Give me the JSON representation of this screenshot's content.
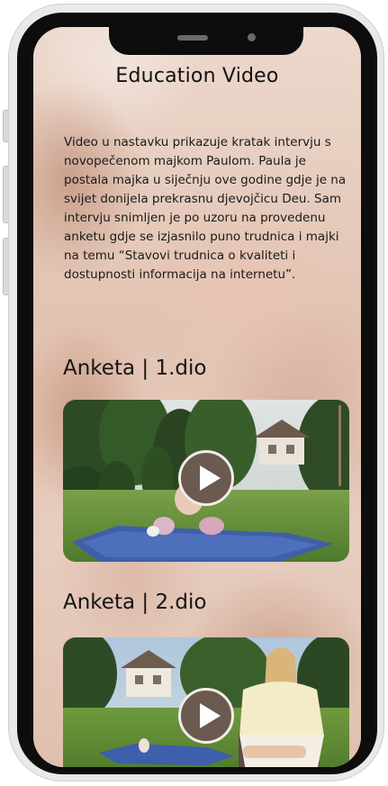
{
  "page": {
    "title": "Education Video",
    "intro": "Video u nastavku prikazuje kratak intervju s novopečenom majkom Paulom. Paula je postala majka u siječnju ove godine gdje je na svijet donijela prekrasnu djevojčicu Deu. Sam intervju snimljen je po uzoru na provedenu anketu gdje se izjasnilo puno trudnica i majki na temu “Stavovi trudnica o kvaliteti i dostupnosti informacija na internetu”."
  },
  "videos": [
    {
      "heading": "Anketa | 1.dio",
      "play_icon": "play-icon"
    },
    {
      "heading": "Anketa | 2.dio",
      "play_icon": "play-icon"
    }
  ],
  "colors": {
    "background_tint": "#e5ccbd",
    "play_button": "#6b5a50",
    "bezel": "#0d0d0d"
  }
}
